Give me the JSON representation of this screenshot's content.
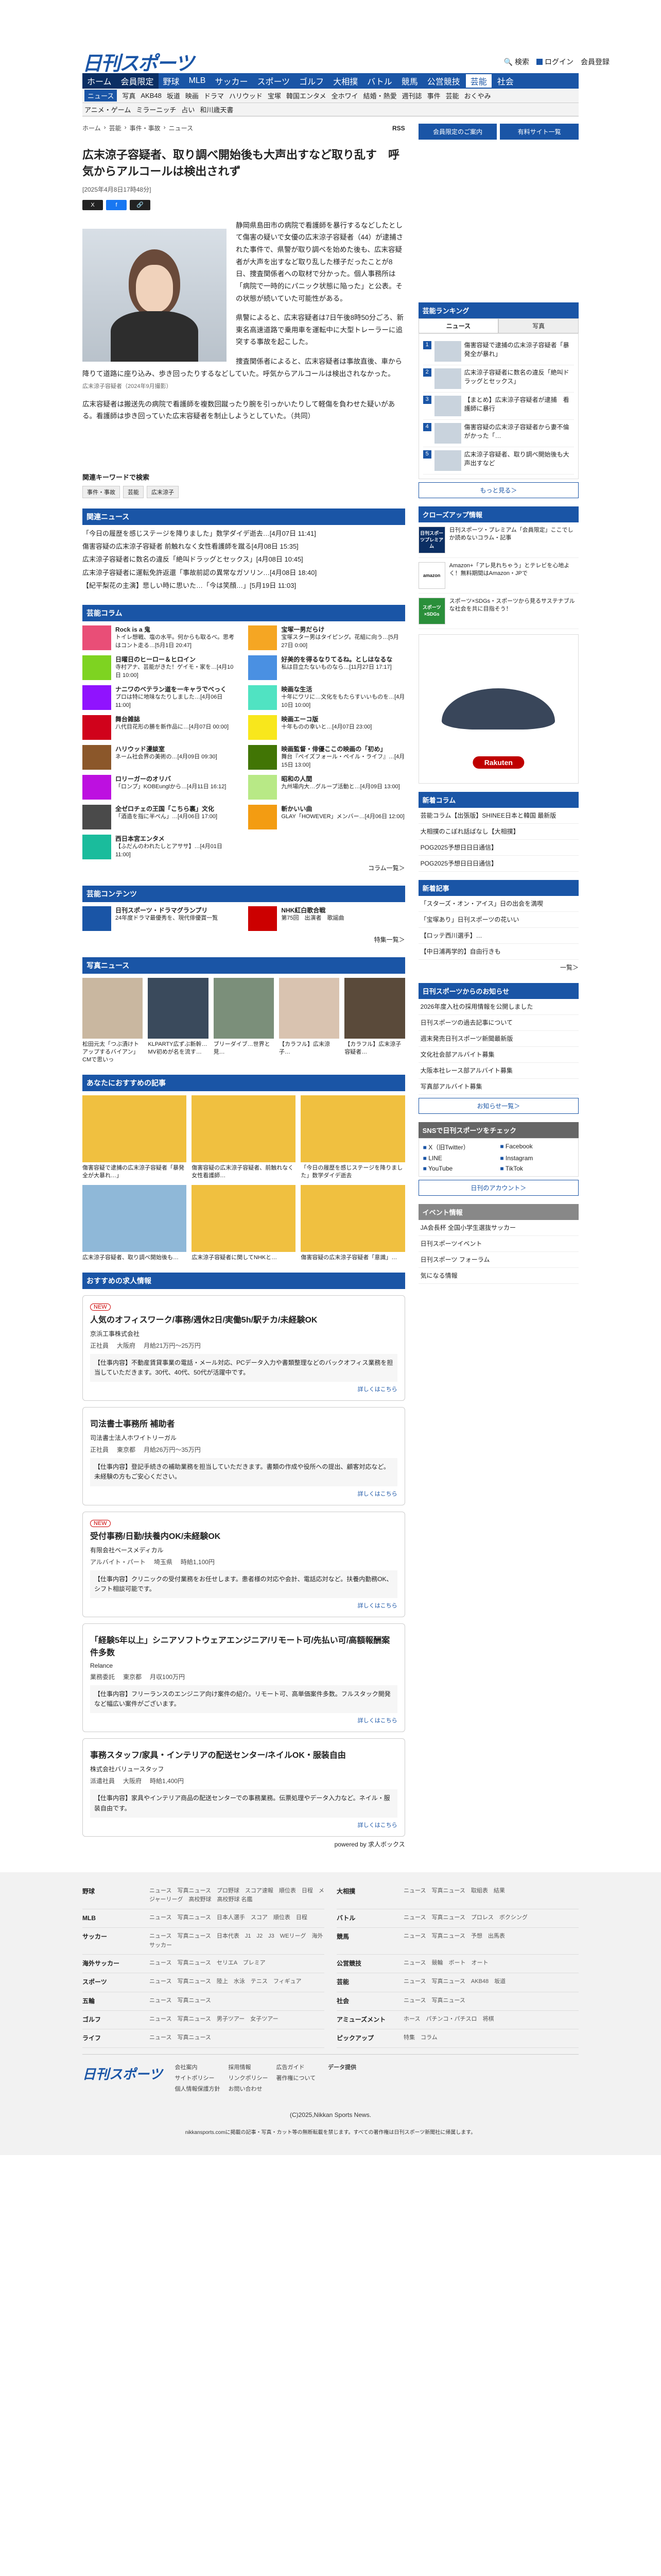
{
  "header": {
    "logo": "日刊スポーツ",
    "search": "検索",
    "login": "ログイン",
    "member": "会員登録"
  },
  "nav1": [
    "ホーム",
    "会員限定",
    "野球",
    "MLB",
    "サッカー",
    "スポーツ",
    "ゴルフ",
    "大相撲",
    "バトル",
    "競馬",
    "公営競技",
    "芸能",
    "社会"
  ],
  "nav2": [
    "ニュース",
    "写真",
    "AKB48",
    "坂道",
    "映画",
    "ドラマ",
    "ハリウッド",
    "宝塚",
    "韓国エンタメ",
    "全ホワイ",
    "結婚・熱愛",
    "週刊誌",
    "事件",
    "芸能",
    "おくやみ"
  ],
  "nav3": [
    "アニメ・ゲーム",
    "ミラーニッチ",
    "占い",
    "和川歳天書"
  ],
  "breadcrumb": [
    "ホーム",
    "芸能",
    "事件・事故",
    "ニュース"
  ],
  "rss": "RSS",
  "article": {
    "title": "広末涼子容疑者、取り調べ開始後も大声出すなど取り乱す　呼気からアルコールは検出されず",
    "date": "[2025年4月8日17時48分]",
    "caption": "広末涼子容疑者（2024年9月撮影）",
    "p1": "静岡県島田市の病院で看護師を暴行するなどしたとして傷害の疑いで女優の広末涼子容疑者（44）が逮捕された事件で、県警が取り調べを始めた後も、広末容疑者が大声を出すなど取り乱した様子だったことが8日、捜査関係者への取材で分かった。個人事務所は「病院で一時的にパニック状態に陥った」と公表。その状態が続いていた可能性がある。",
    "p2": "県警によると、広末容疑者は7日午後8時50分ごろ、新東名高速道路で乗用車を運転中に大型トレーラーに追突する事故を起こした。",
    "p3": "捜査関係者によると、広末容疑者は事故直後、車から降りて道路に座り込み、歩き回ったりするなどしていた。呼気からアルコールは検出されなかった。",
    "p4": "広末容疑者は搬送先の病院で看護師を複数回蹴ったり腕を引っかいたりして軽傷を負わせた疑いがある。看護師は歩き回っていた広末容疑者を制止しようとしていた。（共同）"
  },
  "keywords": {
    "title": "関連キーワードで検索",
    "items": [
      "事件・事故",
      "芸能",
      "広末涼子"
    ]
  },
  "related": {
    "title": "関連ニュース",
    "items": [
      "「今日の履歴を感じステージを降りました」数学ダイデ逝去…[4月07日 11:41]",
      "傷害容疑の広末涼子容疑者 前触れなく女性看護師を蹴る[4月08日 15:35]",
      "広末涼子容疑者に数名の違反「絶叫ドラッグとセックス」[4月08日 10:45]",
      "広末涼子容疑者に運転免許返還「事故前認の異常なガソリン…[4月08日 18:40]",
      "【紀平梨花の主演】悲しい時に思いた…「今は笑顔…」[5月19日 11:03]"
    ]
  },
  "columns": {
    "title": "芸能コラム",
    "items": [
      {
        "t": "Rock is a 鬼",
        "d": "トイレ想戦、塩の水平。何からも取るべ。思考はコント走る…[5月1日 20:47]"
      },
      {
        "t": "宝塚一男だらけ",
        "d": "宝塚スター男はタイピング。花組に向う…[5月27日 0:00]"
      },
      {
        "t": "日曜日のヒーロー＆ヒロイン",
        "d": "寺村アナ、芸能がきた！ゲイモ・家を…[4月10日 10:00]"
      },
      {
        "t": "好美的を得るなりてるね。としはなるな",
        "d": "私は目立たないものなら…[11月27日 17:17]"
      },
      {
        "t": "ナニワのベテラン道を一キャラでべっく",
        "d": "プロは特に地味なたりしました…[4月06日 11:00]"
      },
      {
        "t": "映画な生活",
        "d": "十年にワリに…文化をもたらすいいものを…[4月10日 10:00]"
      },
      {
        "t": "舞台雑誌",
        "d": "八代目花形の勝を新作品に…[4月07日 00:00]"
      },
      {
        "t": "映画エーコ版",
        "d": "十年ものの幸いと…[4月07日 23:00]"
      },
      {
        "t": "ハリウッド漫談室",
        "d": "ネーム社会界の美術の…[4月09日 09:30]"
      },
      {
        "t": "映画監督・俳優ここの映画の「初め」",
        "d": "舞台『ペイズフォール・ペイル・ライフ』…[4月15日 13:00]"
      },
      {
        "t": "ロリーガーのオリバ",
        "d": "「ロンプ」KOBEunglから…[4月11日 16:12]"
      },
      {
        "t": "昭和の人間",
        "d": "九州場内大…グループ活動と…[4月09日 13:00]"
      },
      {
        "t": "全ゼロチェの王国「こちら裏」文化",
        "d": "「酒造を指に半ぺん」…[4月06日 17:00]"
      },
      {
        "t": "斬かいい曲",
        "d": "GLAY「HOWEVER」メンバー…[4月06日 12:00]"
      },
      {
        "t": "西日本宮エンタメ",
        "d": "【ふだんのわれたしとアササ】…[4月01日 11:00]"
      }
    ],
    "more": "コラム一覧＞"
  },
  "contents": {
    "title": "芸能コンテンツ",
    "items": [
      {
        "t": "日刊スポーツ・ドラマグランプリ",
        "d": "24年度ドラマ最優秀を、現代俳優賞一覧"
      },
      {
        "t": "NHK紅白歌合戦",
        "d": "第75回　出演者　歌謡曲"
      }
    ],
    "more": "特集一覧＞"
  },
  "photos": {
    "title": "写真ニュース",
    "items": [
      "松田元太「つぶ漬けトアップするバイアン」CMで思いっ",
      "KLPARTY広ずぶ新幹…MV初めが名を流す…",
      "ブリーダイブ…世界と見…",
      "【カラフル】広末涼子…",
      "【カラフル】広末涼子容疑者…"
    ]
  },
  "recommend": {
    "title": "あなたにおすすめの記事",
    "items": [
      "傷害容疑で逮捕の広末涼子容疑者「暴発全が大暴れ…」",
      "傷害容疑の広末涼子容疑者、前触れなく女性看護師…",
      "「今日の履歴を感じステージを降りました」数学ダイデ逝去",
      "広末涼子容疑者、取り調べ開始後も…",
      "広末涼子容疑者に関してNHKと…",
      "傷害容疑の広末涼子容疑者「意識」…"
    ]
  },
  "jobs": {
    "title": "おすすめの求人情報",
    "items": [
      {
        "new": "NEW",
        "title": "人気のオフィスワーク/事務/週休2日/実働5h/駅チカ/未経験OK",
        "company": "京浜工事株式会社",
        "type": "正社員",
        "place": "大阪府",
        "pay": "月給21万円〜25万円",
        "desc": "【仕事内容】不動産賃貸事業の電話・メール対応、PCデータ入力や書類整理などのバックオフィス業務を担当していただきます。30代、40代、50代が活躍中です。",
        "link": "詳しくはこちら"
      },
      {
        "new": "",
        "title": "司法書士事務所 補助者",
        "company": "司法書士法人ホワイトリーガル",
        "type": "正社員",
        "place": "東京都",
        "pay": "月給26万円〜35万円",
        "desc": "【仕事内容】登記手続きの補助業務を担当していただきます。書類の作成や役所への提出、顧客対応など。未経験の方もご安心ください。",
        "link": "詳しくはこちら"
      },
      {
        "new": "NEW",
        "title": "受付事務/日勤/扶養内OK/未経験OK",
        "company": "有限会社ベースメディカル",
        "type": "アルバイト・パート",
        "place": "埼玉県",
        "pay": "時給1,100円",
        "desc": "【仕事内容】クリニックの受付業務をお任せします。患者様の対応や会計、電話応対など。扶養内勤務OK、シフト相談可能です。",
        "link": "詳しくはこちら"
      },
      {
        "new": "",
        "title": "「経験5年以上」シニアソフトウェアエンジニア/リモート可/先払い可/高額報酬案件多数",
        "company": "Relance",
        "type": "業務委託",
        "place": "東京都",
        "pay": "月収100万円",
        "desc": "【仕事内容】フリーランスのエンジニア向け案件の紹介。リモート可、高単価案件多数。フルスタック開発など幅広い案件がございます。",
        "link": "詳しくはこちら"
      },
      {
        "new": "",
        "title": "事務スタッフ/家具・インテリアの配送センター/ネイルOK・服装自由",
        "company": "株式会社バリュースタッフ",
        "type": "派遣社員",
        "place": "大阪府",
        "pay": "時給1,400円",
        "desc": "【仕事内容】家具やインテリア商品の配送センターでの事務業務。伝票処理やデータ入力など。ネイル・服装自由です。",
        "link": "詳しくはこちら"
      }
    ],
    "powered": "powered by 求人ボックス"
  },
  "side": {
    "btn1": "会員限定のご案内",
    "btn2": "有料サイト一覧",
    "ranking": {
      "title": "芸能ランキング",
      "tabs": [
        "ニュース",
        "写真"
      ],
      "items": [
        "傷害容疑で逮捕の広末涼子容疑者「暴発全が暴れ」",
        "広末涼子容疑者に数名の違反「絶叫ドラッグとセックス」",
        "【まとめ】広末涼子容疑者が逮捕　看護師に暴行",
        "傷害容疑の広末涼子容疑者から妻不倫がかった「…",
        "広末涼子容疑者、取り調べ開始後も大声出すなど"
      ],
      "more": "もっと見る＞"
    },
    "club": {
      "title": "クローズアップ情報",
      "items": [
        {
          "th": "日刊スポーツプレミアム",
          "d": "日刊スポーツ・プレミアム「会員限定」ここでしか読めないコラム・記事"
        },
        {
          "th": "amazon",
          "d": "Amazon+「アレ見れちゃう」とテレビを心地よく！無料期間はAmazon・JPで"
        },
        {
          "th": "スポーツ×SDGs",
          "d": "スポーツ×SDGs・スポーツから見るサステナブルな社会を共に目指そう！"
        }
      ]
    },
    "ad": "Rakuten",
    "newcol": {
      "title": "新着コラム",
      "items": [
        "芸能コラム【出張版】SHINEE日本と韓国 最新版",
        "大相撲のこぼれ話ばなし【大相撲】",
        "POG2025予想日日日通信】",
        "POG2025予想日日日通信】"
      ]
    },
    "sitenews": {
      "title": "新着記事",
      "items": [
        "「スターズ・オン・アイス」日の出会を満喫",
        "「宝塚あり」日刊スポーツの花いい",
        "【ロッテ西川選手】…",
        "【中日浦再学的】自由行きも"
      ],
      "more": "一覧＞"
    },
    "notice": {
      "title": "日刊スポーツからのお知らせ",
      "items": [
        "2026年度入社の採用情報を公開しました",
        "日刊スポーツの過去記事について",
        "週末発売日刊スポーツ新聞最新版",
        "文化社会部アルバイト募集",
        "大阪本社レース部アルバイト募集",
        "写真部アルバイト募集"
      ],
      "more": "お知らせ一覧＞"
    },
    "sns": {
      "title": "SNSで日刊スポーツをチェック",
      "items": [
        "X（旧Twitter）",
        "Facebook",
        "LINE",
        "Instagram",
        "YouTube",
        "TikTok"
      ],
      "btn": "日刊のアカウント＞"
    },
    "events": {
      "title": "イベント情報",
      "items": [
        "JA会長杯 全国小学生選抜サッカー",
        "日刊スポーツイベント",
        "日刊スポーツ フォーラム",
        "気になる情報"
      ]
    }
  },
  "footer": {
    "rows": [
      [
        "野球",
        "ニュース　写真ニュース　プロ野球　スコア速報　順位表　日程　メジャーリーグ　高校野球　高校野球 名鑑"
      ],
      [
        "大相撲",
        "ニュース　写真ニュース　取組表　結果"
      ],
      [
        "MLB",
        "ニュース　写真ニュース　日本人選手　スコア　順位表　日程"
      ],
      [
        "バトル",
        "ニュース　写真ニュース　プロレス　ボクシング"
      ],
      [
        "サッカー",
        "ニュース　写真ニュース　日本代表　J1　J2　J3　WEリーグ　海外サッカー"
      ],
      [
        "競馬",
        "ニュース　写真ニュース　予想　出馬表"
      ],
      [
        "海外サッカー",
        "ニュース　写真ニュース　セリエA　プレミア"
      ],
      [
        "公営競技",
        "ニュース　競輪　ボート　オート"
      ],
      [
        "スポーツ",
        "ニュース　写真ニュース　陸上　水泳　テニス　フィギュア"
      ],
      [
        "芸能",
        "ニュース　写真ニュース　AKB48　坂道"
      ],
      [
        "五輪",
        "ニュース　写真ニュース"
      ],
      [
        "社会",
        "ニュース　写真ニュース"
      ],
      [
        "ゴルフ",
        "ニュース　写真ニュース　男子ツアー　女子ツアー"
      ],
      [
        "アミューズメント",
        "ホース　パチンコ・パチスロ　将棋"
      ],
      [
        "ライフ",
        "ニュース　写真ニュース"
      ],
      [
        "ピックアップ",
        "特集　コラム"
      ]
    ],
    "bottom": [
      "会社案内",
      "採用情報",
      "広告ガイド",
      "サイトポリシー",
      "リンクポリシー",
      "著作権について",
      "個人情報保護方針",
      "お問い合わせ"
    ],
    "data": "データ提供",
    "copyright": "(C)2025,Nikkan Sports News.",
    "note": "nikkansports.comに掲載の記事・写真・カット等の無断転載を禁じます。すべての著作権は日刊スポーツ新聞社に帰属します。"
  }
}
